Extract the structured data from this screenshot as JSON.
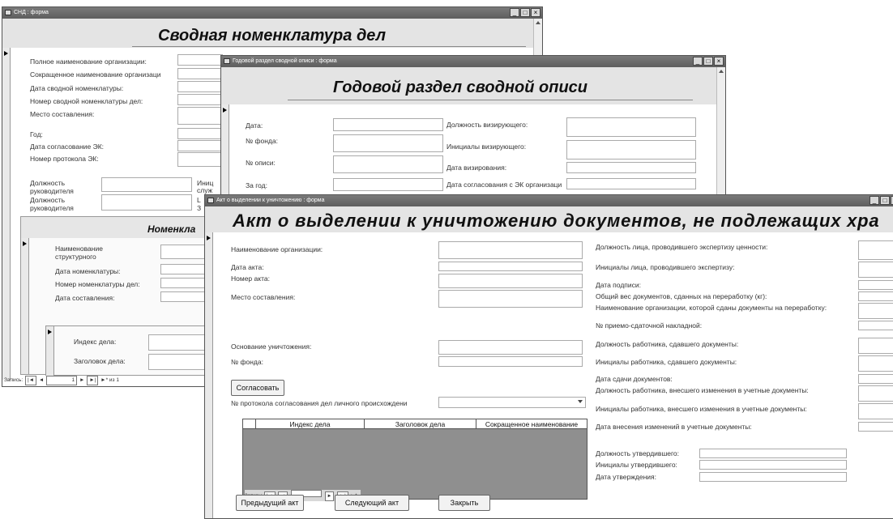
{
  "win1": {
    "title": "СНД : форма",
    "heading": "Сводная номенклатура дел",
    "labels": {
      "full_name": "Полное наименование организации:",
      "short_name": "Сокращенное наименование организаци",
      "date": "Дата сводной номенклатуры:",
      "number": "Номер сводной номенклатуры дел:",
      "place": "Место составления:",
      "year": "Год:",
      "ek_date": "Дата согласование ЭК:",
      "protocol": "Номер протокола ЭК:",
      "head_pos_1": "Должность руководителя",
      "head_pos_2": "Должность руководителя",
      "initials_cut": "Иниц",
      "service_cut": "служ",
      "l_cut": "L",
      "z_cut": "З"
    },
    "sub": {
      "heading": "Номенкла",
      "unit_name": "Наименование структурного",
      "nom_date": "Дата номенклатуры:",
      "nom_number": "Номер номенклатуры дел:",
      "comp_date": "Дата составления:",
      "case_index": "Индекс дела:",
      "case_title": "Заголовок дела:"
    },
    "nav": {
      "label": "Запись:",
      "first": "|◄",
      "prev": "◄",
      "current": "1",
      "next": "►",
      "last": "►|",
      "new": "►*",
      "total": "из 1"
    }
  },
  "win2": {
    "title": "Годовой раздел сводной описи : форма",
    "heading": "Годовой раздел сводной описи",
    "labels": {
      "date": "Дата:",
      "fond": "№ фонда:",
      "inventory": "№ описи:",
      "for_year": "За год:",
      "vis_pos": "Должность визирующего:",
      "vis_initials": "Инициалы визирующего:",
      "vis_date": "Дата визирования:",
      "ek_agreement": "Дата согласования с ЭК организаци"
    }
  },
  "win3": {
    "title": "Акт о выделении к уничтожению : форма",
    "heading": "Акт о выделении к уничтожению документов, не подлежащих хра",
    "left": {
      "org_name": "Наименование организации:",
      "act_date": "Дата акта:",
      "act_number": "Номер акта:",
      "place": "Место составления:",
      "reason": "Основание уничтожения:",
      "fond": "№ фонда:",
      "agree_button": "Согласовать",
      "protocol": "№ протокола согласования дел личного происхождени"
    },
    "grid": {
      "columns": [
        "Индекс дела",
        "Заголовок дела",
        "Сокращенное наименование"
      ],
      "nav_label": "Запись:",
      "nav_first": "|◄",
      "nav_prev": "◄",
      "nav_next": "►",
      "nav_last": "►|",
      "nav_new": "►*"
    },
    "right": {
      "expert_pos": "Должность лица, проводившего экспертизу ценности:",
      "expert_initials": "Инициалы лица, проводившего экспертизу:",
      "sign_date": "Дата подписи:",
      "total_weight": "Общий вес документов, сданных на переработку (кг):",
      "recycler_org": "Наименование организации, которой сданы документы на переработку:",
      "waybill": "№ приемо-сдаточной накладной:",
      "worker_pos": "Должность работника, сдавшего документы:",
      "worker_initials": "Инициалы работника, сдавшего документы:",
      "handover_date": "Дата сдачи документов:",
      "editor_pos": "Должность работника, внесшего изменения в учетные документы:",
      "editor_initials": "Инициалы работника, внесшего изменения в учетные документы:",
      "edit_date": "Дата внесения изменений в учетные документы:",
      "approver_pos": "Должность утвердившего:",
      "approver_initials": "Инициалы утвердившего:",
      "approve_date": "Дата утверждения:"
    },
    "buttons": {
      "prev": "Предыдущий акт",
      "next": "Следующий акт",
      "close": "Закрыть"
    }
  }
}
